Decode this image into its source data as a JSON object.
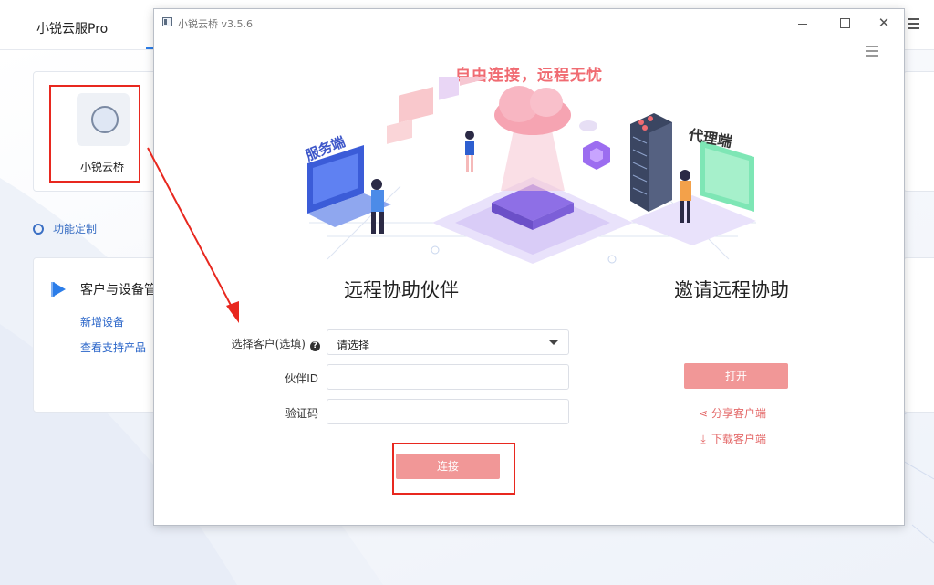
{
  "background_app": {
    "title": "小锐云服Pro",
    "app_tile_label": "小锐云桥",
    "customize_label": "功能定制",
    "panel": {
      "title": "客户与设备管理",
      "links": [
        "新增设备",
        "查看支持产品"
      ]
    }
  },
  "dialog": {
    "title": "小锐云桥 v3.5.6",
    "slogan": "自由连接，远程无忧",
    "illustration": {
      "server_tag": "服务端",
      "agent_tag": "代理端"
    },
    "left_section": {
      "heading": "远程协助伙伴",
      "customer_label": "选择客户(选填)",
      "customer_select_value": "请选择",
      "partner_id_label": "伙伴ID",
      "partner_id_value": "",
      "verify_code_label": "验证码",
      "verify_code_value": "",
      "connect_button": "连接"
    },
    "right_section": {
      "heading": "邀请远程协助",
      "open_button": "打开",
      "share_link": "分享客户端",
      "download_link": "下载客户端"
    }
  },
  "colors": {
    "accent_pink": "#f19797",
    "slogan_pink": "#f06b72",
    "link_red": "#e46a6a",
    "annotation_red": "#e8281f",
    "brand_blue": "#2b7de9"
  },
  "icons": {
    "window_controls": [
      "minimize-icon",
      "maximize-icon",
      "close-icon"
    ],
    "menu": "hamburger-menu-icon",
    "help": "question-circle-icon",
    "share": "share-icon",
    "download": "download-icon",
    "settings": "gear-icon"
  }
}
